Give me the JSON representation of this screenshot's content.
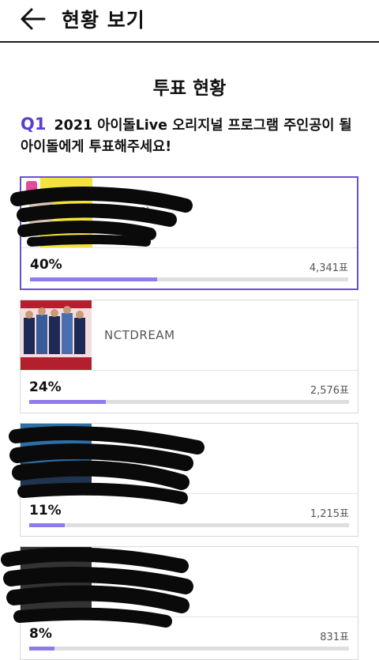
{
  "header": {
    "title": "현황 보기"
  },
  "section_title": "투표 현황",
  "question": {
    "number": "Q1",
    "text": "2021 아이돌Live 오리지널 프로그램 주인공이 될 아이돌에게 투표해주세요!"
  },
  "candidates": [
    {
      "name": "아이즈원",
      "percent_label": "40%",
      "percent": 40,
      "votes_label": "4,341표",
      "selected": true,
      "thumb_color": "#f4e33a"
    },
    {
      "name": "NCTDREAM",
      "percent_label": "24%",
      "percent": 24,
      "votes_label": "2,576표",
      "selected": false,
      "thumb_color": "#b31f2c"
    },
    {
      "name": "",
      "percent_label": "11%",
      "percent": 11,
      "votes_label": "1,215표",
      "selected": false,
      "thumb_color": "#2e6fa6"
    },
    {
      "name": "",
      "percent_label": "8%",
      "percent": 8,
      "votes_label": "831표",
      "selected": false,
      "thumb_color": "#333333"
    }
  ],
  "colors": {
    "accent": "#6a4fd6",
    "bar_fill": "#8f7bec",
    "bar_bg": "#dedede"
  }
}
